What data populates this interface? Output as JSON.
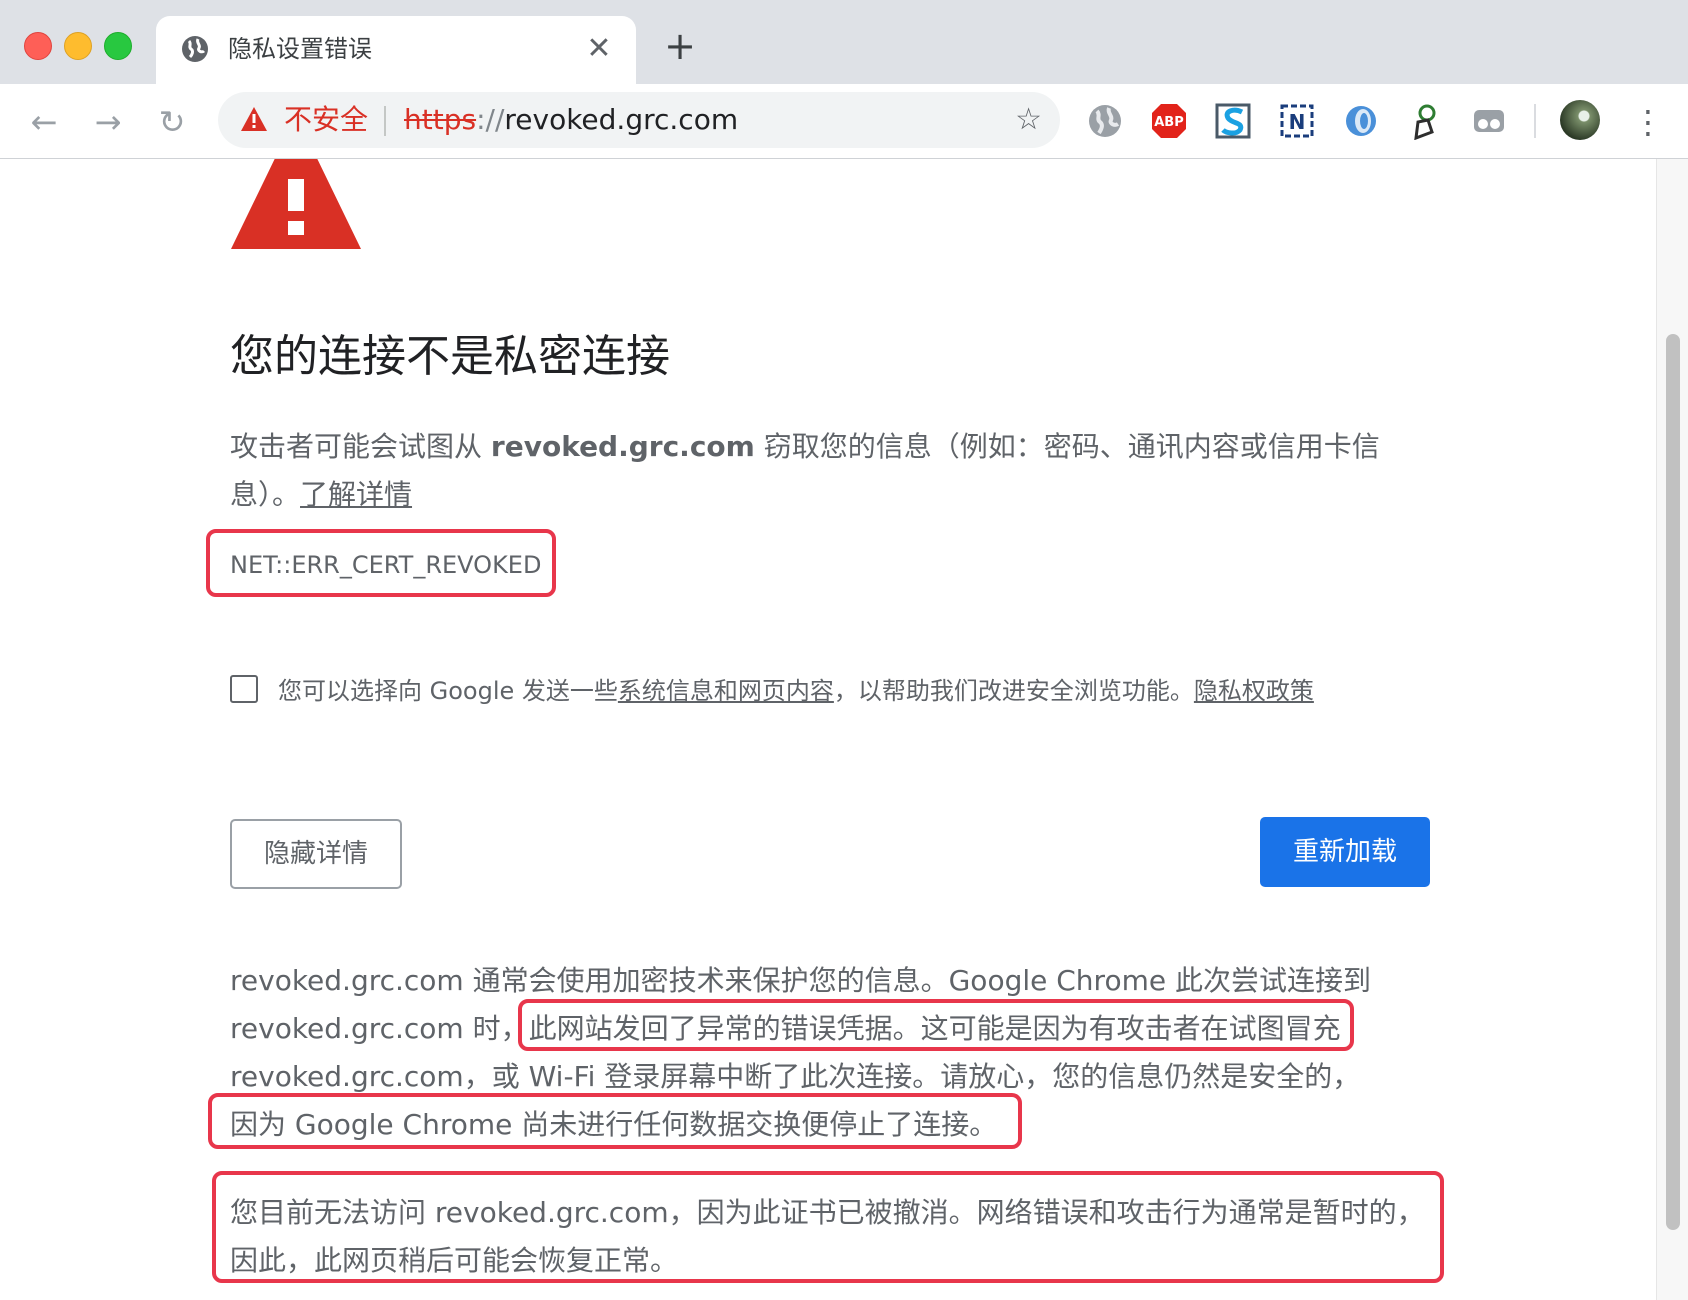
{
  "browser": {
    "tab": {
      "title": "隐私设置错误",
      "close_glyph": "✕"
    },
    "new_tab_glyph": "+",
    "nav": {
      "back_glyph": "←",
      "forward_glyph": "→",
      "reload_glyph": "↻"
    },
    "omnibox": {
      "security_label": "不安全",
      "url_scheme": "https",
      "url_separator": "://",
      "url_host": "revoked.grc.com",
      "bookmark_glyph": "☆"
    },
    "extensions": [
      "globe-icon",
      "adblock-plus-icon",
      "s-extension-icon",
      "n-extension-icon",
      "circle-extension-icon",
      "grammar-extension-icon",
      "incognito-extension-icon"
    ],
    "menu_glyph": "⋮"
  },
  "page": {
    "heading": "您的连接不是私密连接",
    "intro": {
      "before": "攻击者可能会试图从 ",
      "host": "revoked.grc.com",
      "after": " 窃取您的信息（例如：密码、通讯内容或信用卡信息）。",
      "learn_more": "了解详情"
    },
    "error_code": "NET::ERR_CERT_REVOKED",
    "opt_in": {
      "before": "您可以选择向 Google 发送一些",
      "link1": "系统信息和网页内容",
      "middle": "，以帮助我们改进安全浏览功能。",
      "link2": "隐私权政策"
    },
    "buttons": {
      "hide_details": "隐藏详情",
      "reload": "重新加载"
    },
    "details": {
      "line1": "revoked.grc.com 通常会使用加密技术来保护您的信息。Google Chrome 此次尝试连接到",
      "line2_prefix": "revoked.grc.com 时，",
      "line2_highlight": "此网站发回了异常的错误凭据。这可能是因为有攻击者在试图冒充",
      "line3": "revoked.grc.com，或 Wi-Fi 登录屏幕中断了此次连接。请放心，您的信息仍然是安全的，",
      "line4": "因为 Google Chrome 尚未进行任何数据交换便停止了连接。",
      "paragraph2": "您目前无法访问 revoked.grc.com，因为此证书已被撤消。网络错误和攻击行为通常是暂时的，因此，此网页稍后可能会恢复正常。"
    }
  },
  "colors": {
    "highlight_border": "#e8364b",
    "warning_red": "#d93025",
    "primary_button": "#1a73e8"
  }
}
